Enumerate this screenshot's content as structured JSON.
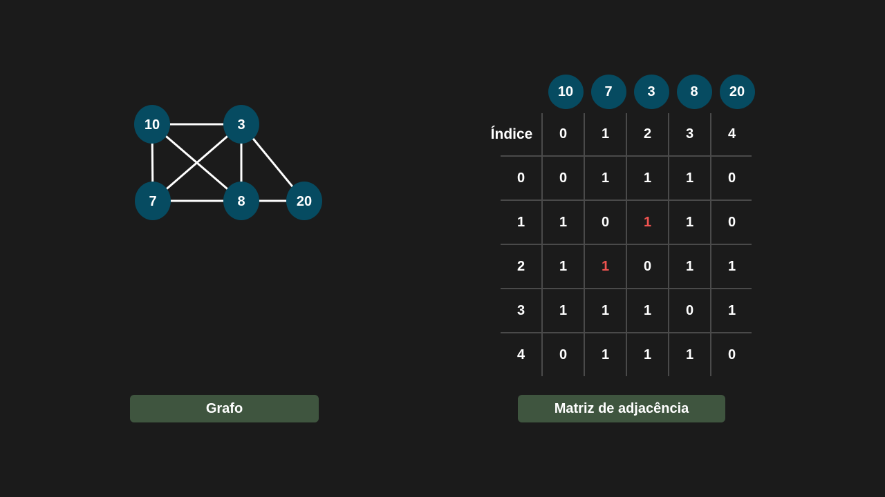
{
  "graph": {
    "nodes": [
      {
        "id": "n10",
        "label": "10"
      },
      {
        "id": "n3",
        "label": "3"
      },
      {
        "id": "n7",
        "label": "7"
      },
      {
        "id": "n8",
        "label": "8"
      },
      {
        "id": "n20",
        "label": "20"
      }
    ],
    "edges": [
      [
        "n10",
        "n3"
      ],
      [
        "n10",
        "n7"
      ],
      [
        "n10",
        "n8"
      ],
      [
        "n3",
        "n7"
      ],
      [
        "n3",
        "n8"
      ],
      [
        "n3",
        "n20"
      ],
      [
        "n7",
        "n8"
      ],
      [
        "n8",
        "n20"
      ]
    ],
    "caption": "Grafo"
  },
  "matrix": {
    "index_label": "Índice",
    "header_nodes": [
      "10",
      "7",
      "3",
      "8",
      "20"
    ],
    "col_indices": [
      "0",
      "1",
      "2",
      "3",
      "4"
    ],
    "row_indices": [
      "0",
      "1",
      "2",
      "3",
      "4"
    ],
    "rows": [
      [
        "0",
        "1",
        "1",
        "1",
        "0"
      ],
      [
        "1",
        "0",
        "1",
        "1",
        "0"
      ],
      [
        "1",
        "1",
        "0",
        "1",
        "1"
      ],
      [
        "1",
        "1",
        "1",
        "0",
        "1"
      ],
      [
        "0",
        "1",
        "1",
        "1",
        "0"
      ]
    ],
    "highlighted_cells": [
      [
        1,
        2
      ],
      [
        2,
        1
      ]
    ],
    "caption": "Matriz de adjacência"
  },
  "colors": {
    "background": "#1b1b1b",
    "node_fill": "#064b61",
    "edge": "#ffffff",
    "highlight": "#ef5350",
    "caption_bg": "#3f553f",
    "grid_line": "#4a4a4a"
  }
}
